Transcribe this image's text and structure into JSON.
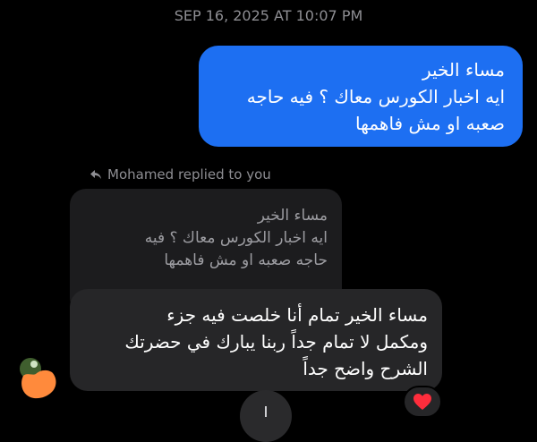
{
  "thread": {
    "timestamp": "SEP 16, 2025 AT 10:07 PM"
  },
  "sent_message": {
    "lines": [
      "مساء الخير",
      "ايه اخبار الكورس معاك ؟ فيه حاجه",
      "صعبه او مش فاهمها"
    ]
  },
  "reply_context": {
    "label": "Mohamed replied to you",
    "quoted_lines": [
      "مساء الخير",
      "ايه اخبار الكورس معاك ؟ فيه",
      "حاجه صعبه او مش فاهمها"
    ]
  },
  "received_message": {
    "lines": [
      "مساء الخير تمام أنا خلصت فيه جزء",
      "ومكمل لا تمام جداً ربنا يبارك في حضرتك",
      "الشرح واضح جداً"
    ]
  },
  "reaction": {
    "icon": "red-heart-icon",
    "color": "#ff2d3c"
  },
  "colors": {
    "sent_bubble": "#1d6ff2",
    "received_bubble": "#262628",
    "quoted_bubble": "#1c1c1e"
  }
}
